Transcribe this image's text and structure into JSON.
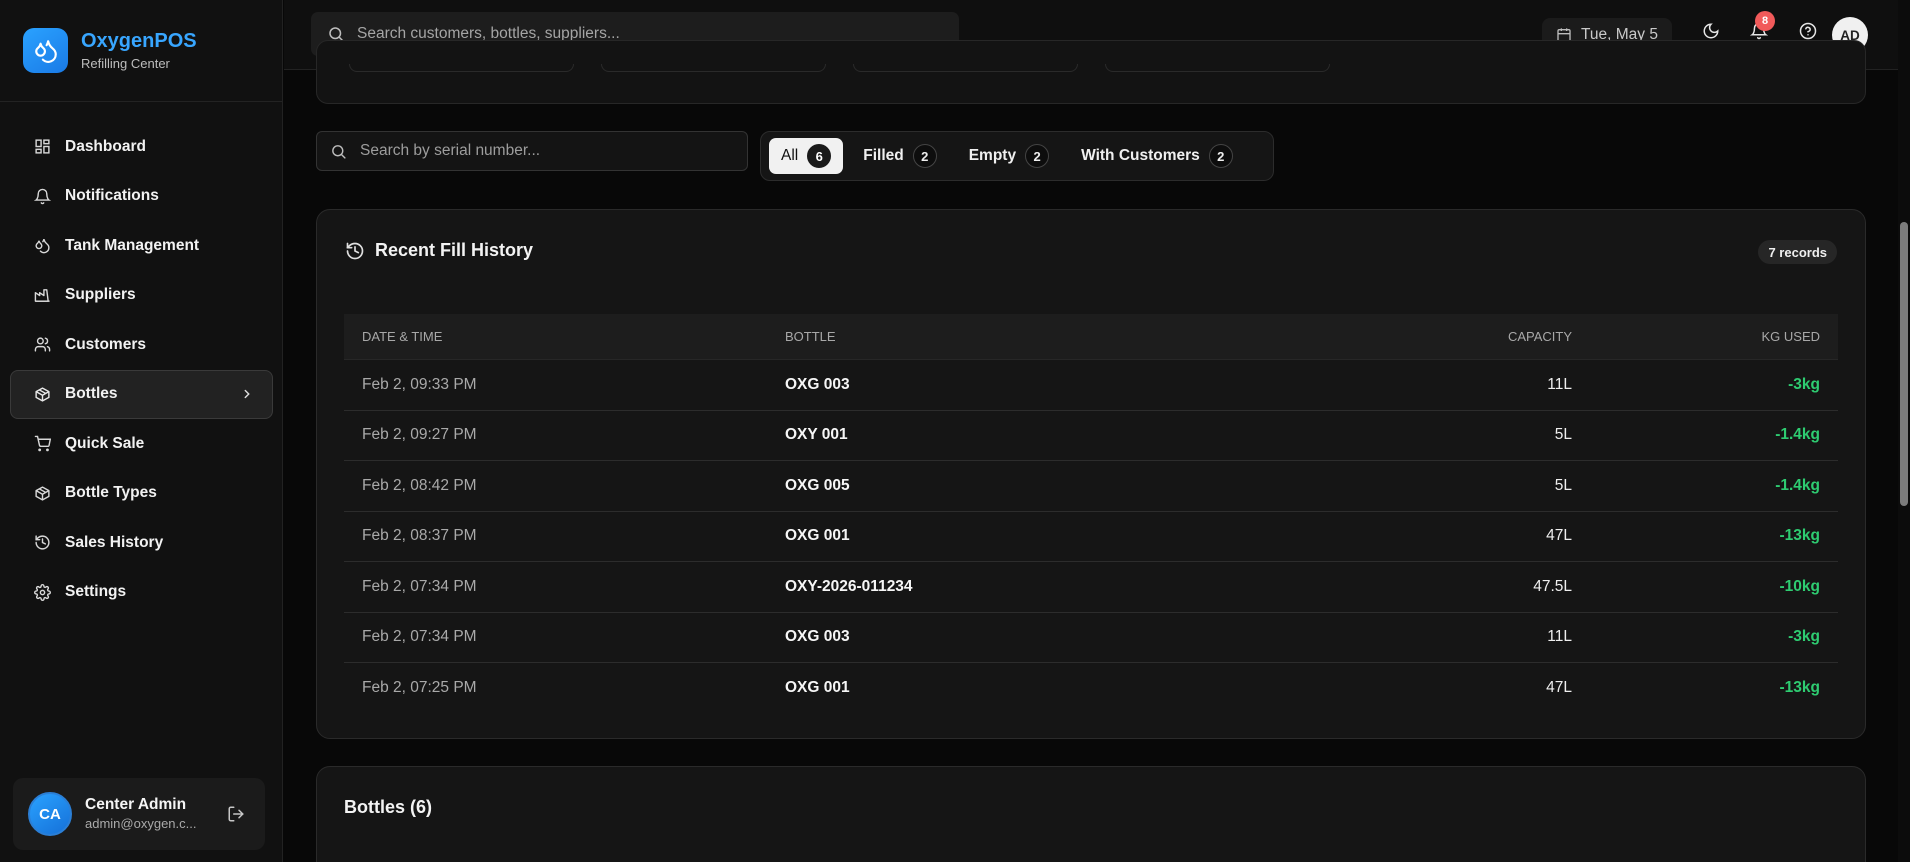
{
  "brand": {
    "name": "OxygenPOS",
    "subtitle": "Refilling Center"
  },
  "sidebar": {
    "items": [
      {
        "label": "Dashboard",
        "icon": "dashboard-icon"
      },
      {
        "label": "Notifications",
        "icon": "bell-icon"
      },
      {
        "label": "Tank Management",
        "icon": "droplets-icon"
      },
      {
        "label": "Suppliers",
        "icon": "factory-icon"
      },
      {
        "label": "Customers",
        "icon": "users-icon"
      },
      {
        "label": "Bottles",
        "icon": "package-icon",
        "active": true
      },
      {
        "label": "Quick Sale",
        "icon": "cart-icon"
      },
      {
        "label": "Bottle Types",
        "icon": "package-icon"
      },
      {
        "label": "Sales History",
        "icon": "history-icon"
      },
      {
        "label": "Settings",
        "icon": "gear-icon"
      }
    ]
  },
  "user": {
    "initials": "CA",
    "name": "Center Admin",
    "email": "admin@oxygen.c..."
  },
  "topbar": {
    "search_placeholder": "Search customers, bottles, suppliers...",
    "date": "Tue, May 5",
    "notification_count": "8",
    "avatar_initials": "AD"
  },
  "filters": {
    "search_placeholder": "Search by serial number...",
    "tabs": [
      {
        "label": "All",
        "count": "6",
        "active": true
      },
      {
        "label": "Filled",
        "count": "2"
      },
      {
        "label": "Empty",
        "count": "2"
      },
      {
        "label": "With Customers",
        "count": "2"
      }
    ]
  },
  "history": {
    "title": "Recent Fill History",
    "records_label": "7 records",
    "columns": {
      "date": "DATE & TIME",
      "bottle": "BOTTLE",
      "capacity": "CAPACITY",
      "kg": "KG USED"
    },
    "rows": [
      {
        "date": "Feb 2, 09:33 PM",
        "bottle": "OXG 003",
        "capacity": "11L",
        "kg": "-3kg"
      },
      {
        "date": "Feb 2, 09:27 PM",
        "bottle": "OXY 001",
        "capacity": "5L",
        "kg": "-1.4kg"
      },
      {
        "date": "Feb 2, 08:42 PM",
        "bottle": "OXG 005",
        "capacity": "5L",
        "kg": "-1.4kg"
      },
      {
        "date": "Feb 2, 08:37 PM",
        "bottle": "OXG 001",
        "capacity": "47L",
        "kg": "-13kg"
      },
      {
        "date": "Feb 2, 07:34 PM",
        "bottle": "OXY-2026-011234",
        "capacity": "47.5L",
        "kg": "-10kg"
      },
      {
        "date": "Feb 2, 07:34 PM",
        "bottle": "OXG 003",
        "capacity": "11L",
        "kg": "-3kg"
      },
      {
        "date": "Feb 2, 07:25 PM",
        "bottle": "OXG 001",
        "capacity": "47L",
        "kg": "-13kg"
      }
    ]
  },
  "bottles_section": {
    "title": "Bottles (6)"
  },
  "colors": {
    "accent": "#38a6ff",
    "positive": "#2ecc71",
    "badge": "#f15a5a",
    "background": "#080808"
  }
}
